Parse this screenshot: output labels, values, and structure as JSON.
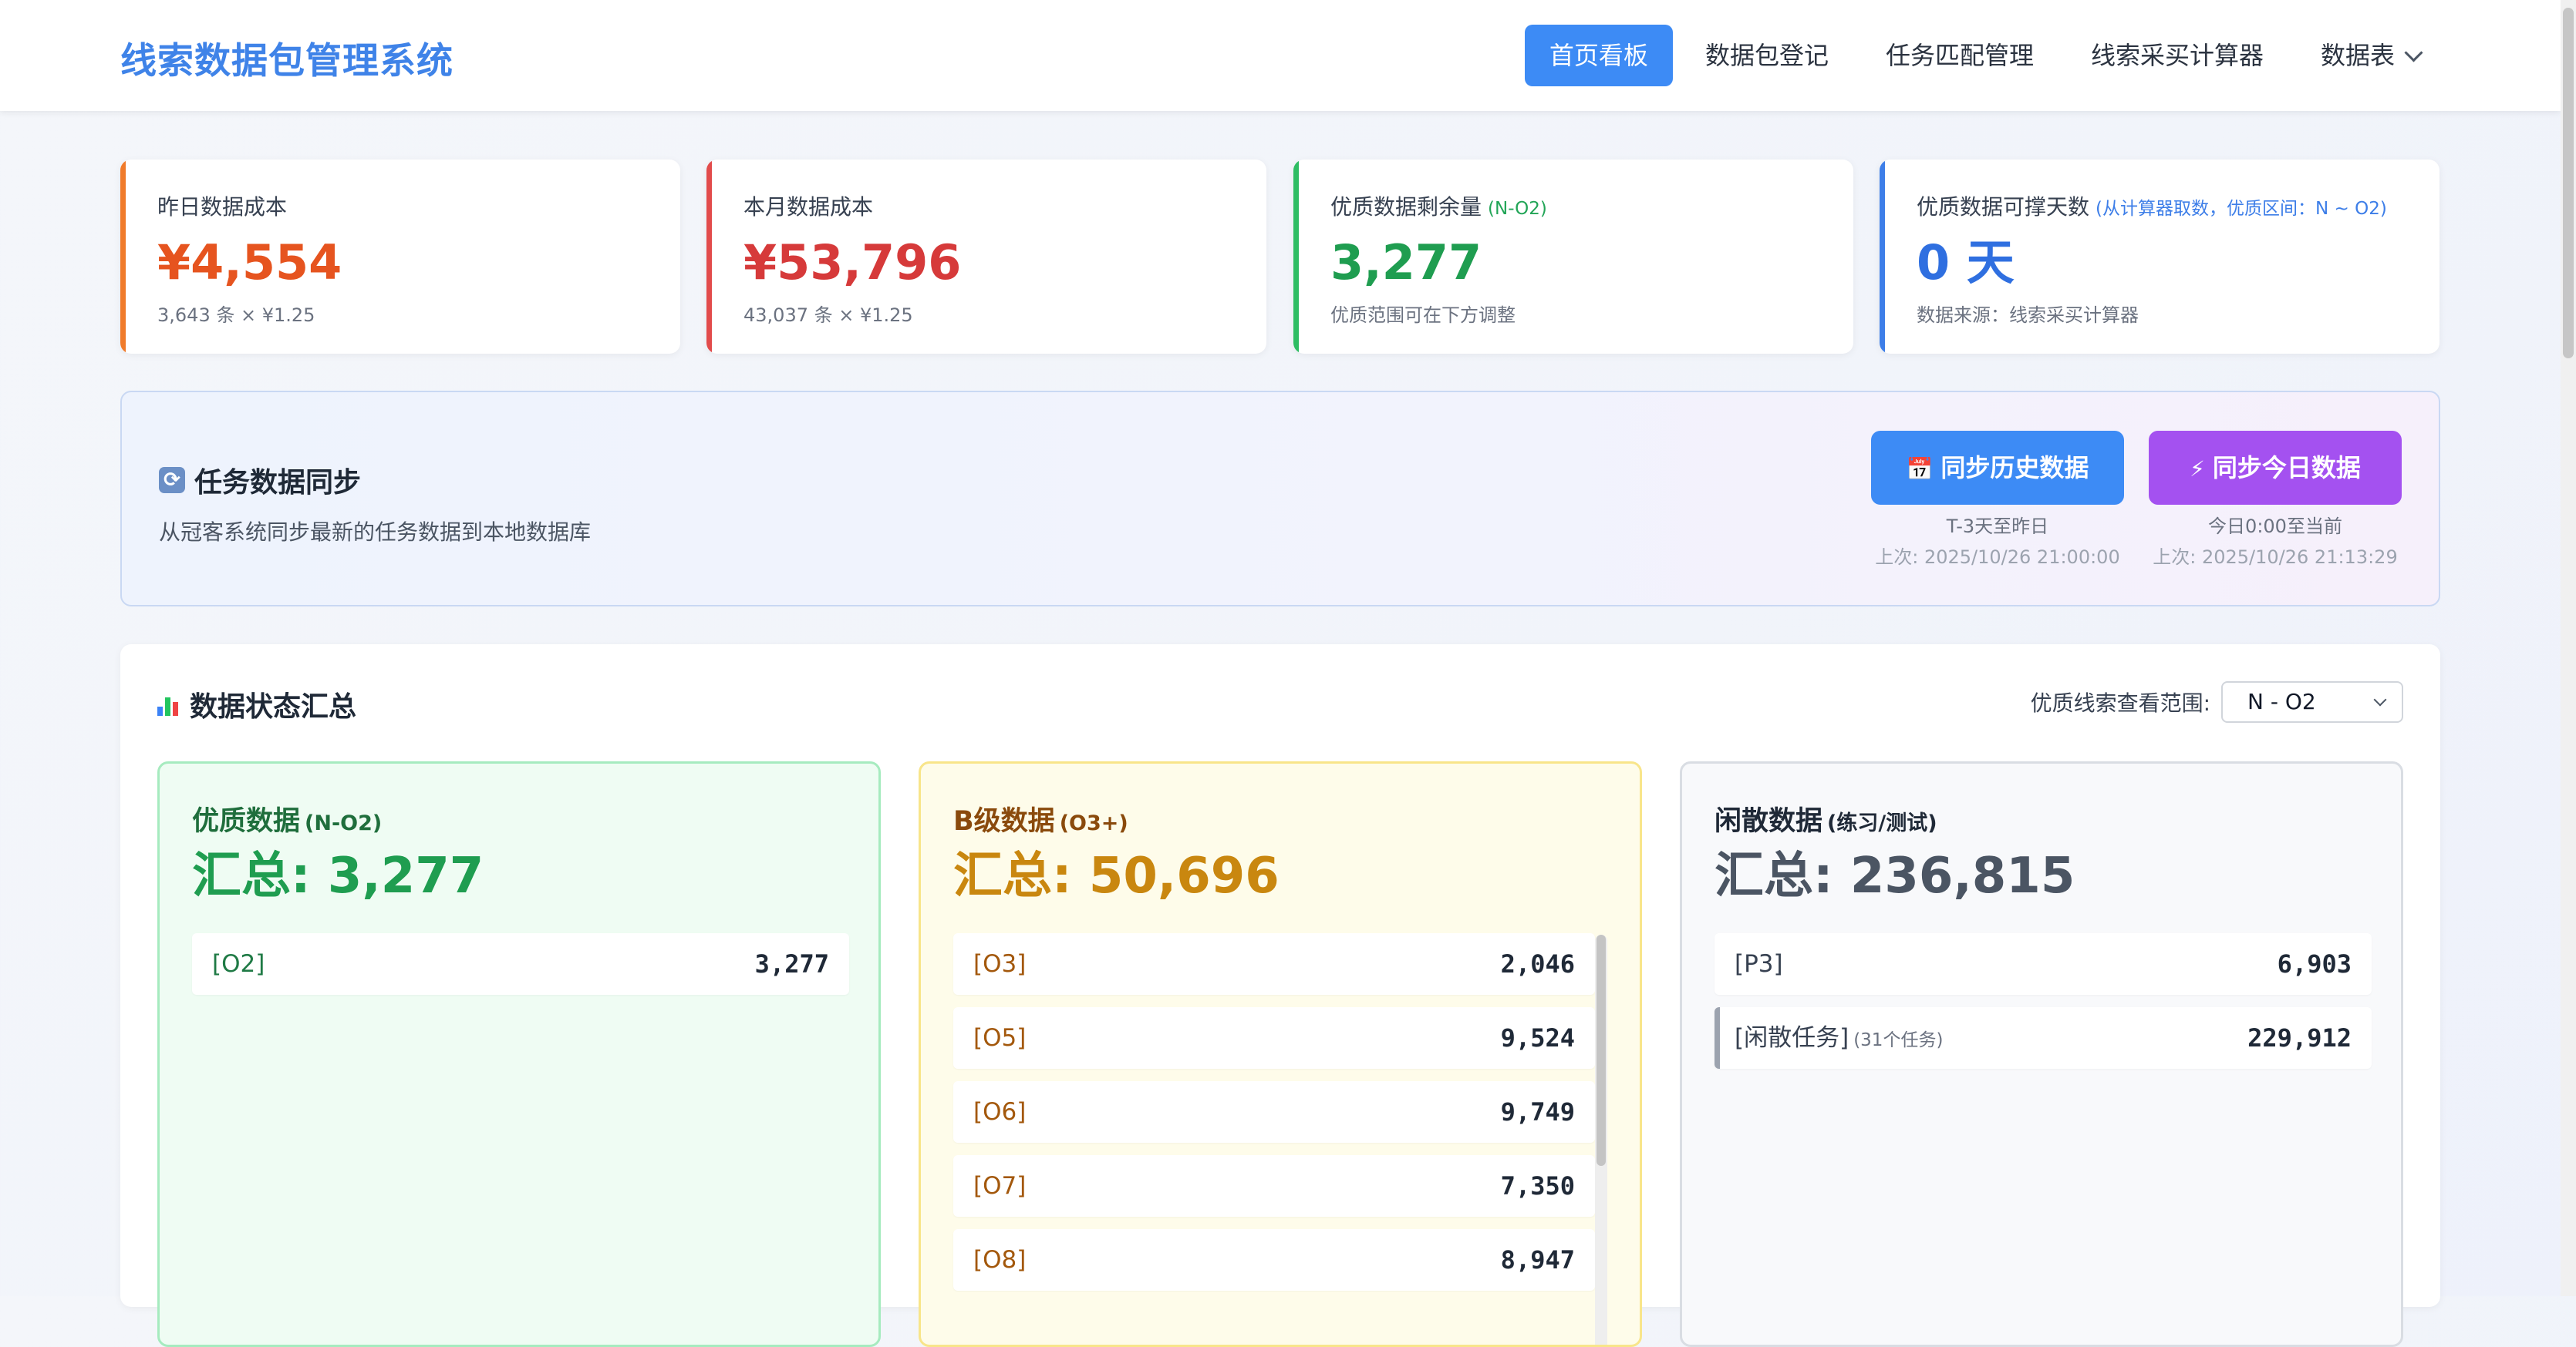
{
  "app": {
    "title": "线索数据包管理系统"
  },
  "nav": {
    "items": [
      {
        "label": "首页看板",
        "active": true
      },
      {
        "label": "数据包登记",
        "active": false
      },
      {
        "label": "任务匹配管理",
        "active": false
      },
      {
        "label": "线索采买计算器",
        "active": false
      },
      {
        "label": "数据表",
        "active": false
      }
    ]
  },
  "stats": [
    {
      "label": "昨日数据成本",
      "sub": "",
      "value": "¥4,554",
      "note": "3,643 条 × ¥1.25",
      "accent": "#f07b2b",
      "value_color": "#e6541f",
      "sub_color": ""
    },
    {
      "label": "本月数据成本",
      "sub": "",
      "value": "¥53,796",
      "note": "43,037 条 × ¥1.25",
      "accent": "#e24b4b",
      "value_color": "#d63a3a",
      "sub_color": ""
    },
    {
      "label": "优质数据剩余量",
      "sub": "(N-O2)",
      "value": "3,277",
      "note": "优质范围可在下方调整",
      "accent": "#2ebd63",
      "value_color": "#1f9d50",
      "sub_color": "#22a557"
    },
    {
      "label": "优质数据可撑天数",
      "sub": "(从计算器取数，优质区间：N ~ O2)",
      "value": "0 天",
      "note": "数据来源：线索采买计算器",
      "accent": "#3d7ee8",
      "value_color": "#2f6fe0",
      "sub_color": "#3d7ee8"
    }
  ],
  "sync": {
    "title": "任务数据同步",
    "icon": "sync-icon",
    "description": "从冠客系统同步最新的任务数据到本地数据库",
    "history": {
      "label": "同步历史数据",
      "icon": "calendar-icon",
      "glyph": "📅",
      "range": "T-3天至昨日",
      "last": "上次: 2025/10/26 21:00:00",
      "color": "#3d8bf5"
    },
    "today": {
      "label": "同步今日数据",
      "icon": "lightning-icon",
      "glyph": "⚡",
      "range": "今日0:00至当前",
      "last": "上次: 2025/10/26 21:13:29",
      "color": "#a451f0"
    }
  },
  "summary": {
    "title": "数据状态汇总",
    "icon": "bar-chart-icon",
    "range_label": "优质线索查看范围:",
    "range_value": "N - O2",
    "columns": [
      {
        "title": "优质数据",
        "sub": "(N-O2)",
        "total": "汇总: 3,277",
        "title_color": "#1f6e3c",
        "total_color": "#1f9d50",
        "key_color": "#1f7a45",
        "bg": "#effcf3",
        "border": "#a6ebbf",
        "rows": [
          {
            "key": "[O2]",
            "value": "3,277",
            "sub": ""
          }
        ]
      },
      {
        "title": "B级数据",
        "sub": "(O3+)",
        "total": "汇总: 50,696",
        "title_color": "#8a4a0c",
        "total_color": "#c9870f",
        "key_color": "#a3580c",
        "bg": "#fefcea",
        "border": "#f8e58a",
        "rows": [
          {
            "key": "[O3]",
            "value": "2,046",
            "sub": ""
          },
          {
            "key": "[O5]",
            "value": "9,524",
            "sub": ""
          },
          {
            "key": "[O6]",
            "value": "9,749",
            "sub": ""
          },
          {
            "key": "[O7]",
            "value": "7,350",
            "sub": ""
          },
          {
            "key": "[O8]",
            "value": "8,947",
            "sub": ""
          }
        ]
      },
      {
        "title": "闲散数据",
        "sub": "(练习/测试)",
        "total": "汇总: 236,815",
        "title_color": "#1f2937",
        "total_color": "#4b5563",
        "key_color": "#374151",
        "bg": "#f8f9fb",
        "border": "#d9dde3",
        "rows": [
          {
            "key": "[P3]",
            "value": "6,903",
            "sub": ""
          },
          {
            "key": "[闲散任务]",
            "value": "229,912",
            "sub": "(31个任务)"
          }
        ]
      }
    ]
  }
}
